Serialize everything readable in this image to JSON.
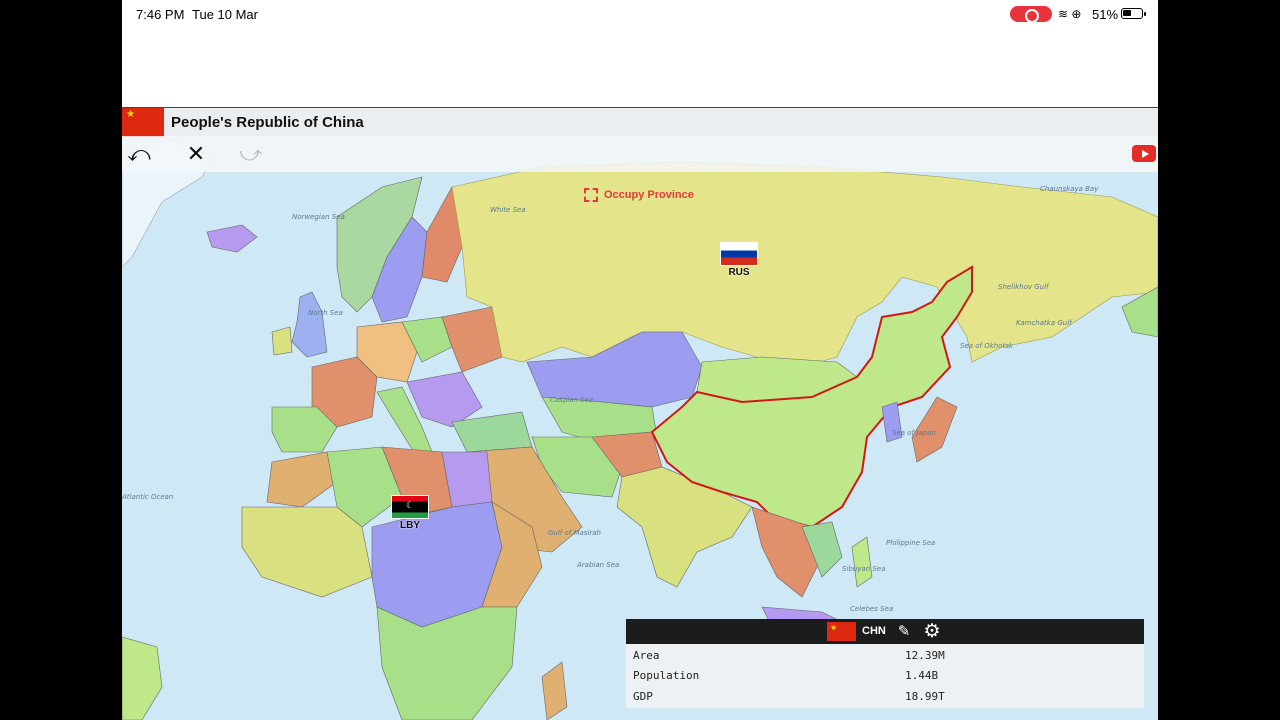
{
  "status_bar": {
    "time": "7:46 PM",
    "date": "Tue 10 Mar",
    "battery": "51%",
    "icons": "wifi, orientation-lock, battery"
  },
  "header": {
    "country_name": "People's Republic of China",
    "flag_icon": "china-flag-icon"
  },
  "toolbar": {
    "undo": "undo-icon",
    "close": "close-icon",
    "redo": "redo-icon",
    "youtube": "youtube-icon"
  },
  "map": {
    "action_label": "Occupy Province",
    "markers": [
      {
        "code": "RUS",
        "flag": "russia-flag-icon"
      },
      {
        "code": "LBY",
        "flag": "libya-flag-icon"
      }
    ],
    "sea_labels": [
      "Norwegian Sea",
      "White Sea",
      "North Sea",
      "Chaunskaya Bay",
      "Shelikhov Gulf",
      "Kamchatka Gulf",
      "Sea of Okhotsk",
      "Sea of Japan",
      "Philippine Sea",
      "Gulf of Masirah",
      "Arabian Sea",
      "Celebes Sea",
      "Sibuyan Sea",
      "Atlantic Ocean",
      "Caspian Sea"
    ],
    "colors": {
      "water": "#cfe8f6",
      "russia": "#e4e48a",
      "china": "#bfe88a",
      "china_border": "#d01818"
    }
  },
  "info_panel": {
    "country_code": "CHN",
    "stats": [
      {
        "label": "Area",
        "value": "12.39M"
      },
      {
        "label": "Population",
        "value": "1.44B"
      },
      {
        "label": "GDP",
        "value": "18.99T"
      }
    ]
  }
}
